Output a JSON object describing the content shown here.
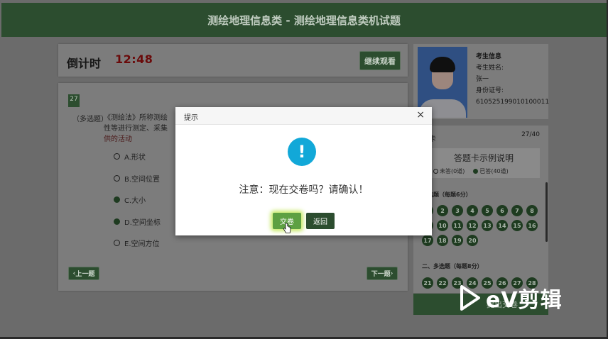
{
  "header": {
    "title": "测绘地理信息类 - 测绘地理信息类机试题"
  },
  "timer": {
    "label": "倒计时",
    "value": "12:48",
    "continue_label": "继续观看"
  },
  "question": {
    "number": "27",
    "type": "（多选题）",
    "text_main": "《测绘法》所称测绘",
    "text_line2": "性等进行测定、采集",
    "text_tail": "供的活动",
    "options": [
      {
        "label": "A.形状",
        "selected": false
      },
      {
        "label": "B.空间位置",
        "selected": false
      },
      {
        "label": "C.大小",
        "selected": true
      },
      {
        "label": "D.空间坐标",
        "selected": true
      },
      {
        "label": "E.空间方位",
        "selected": false
      }
    ],
    "prev_label": "上一题",
    "next_label": "下一题"
  },
  "profile": {
    "title": "考生信息",
    "name_label": "考生姓名:",
    "name_value": "张一",
    "id_label": "身份证号:",
    "id_value": "610525199010100011"
  },
  "answer_card": {
    "title": "题卡",
    "count": "27/40",
    "legend_title": "答题卡示例说明",
    "legend_unanswered": "未答(0道)",
    "legend_answered": "已答(40道)",
    "section1_title": "单选题（每题6分）",
    "section1_numbers": [
      "1",
      "2",
      "3",
      "4",
      "5",
      "6",
      "7",
      "8",
      "9",
      "10",
      "11",
      "12",
      "13",
      "14",
      "15",
      "16",
      "17",
      "18",
      "19",
      "20"
    ],
    "section2_title": "二、多选题（每题8分）",
    "section2_numbers": [
      "21",
      "22",
      "23",
      "24",
      "25",
      "26",
      "27",
      "28"
    ],
    "submit_label": "提出交卷"
  },
  "modal": {
    "title": "提示",
    "close": "×",
    "message": "注意：现在交卷吗？请确认！",
    "confirm_label": "交卷",
    "back_label": "返回"
  },
  "watermark": {
    "text": "eV剪辑"
  }
}
